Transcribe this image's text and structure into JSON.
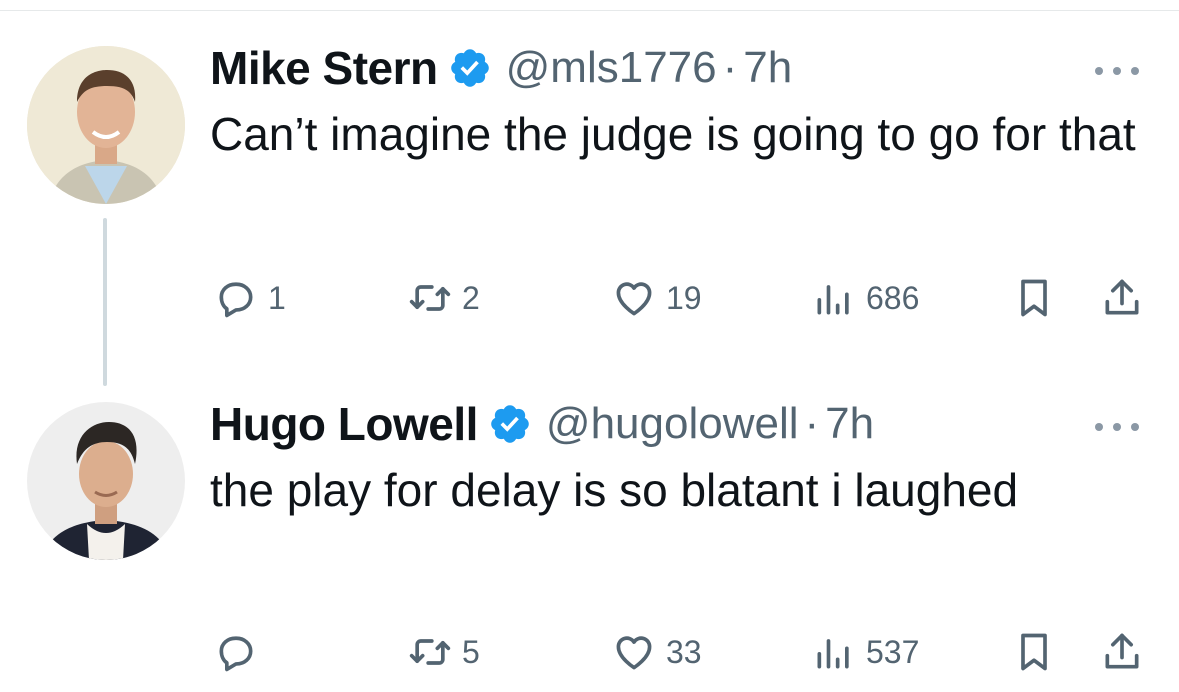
{
  "tweets": [
    {
      "name": "Mike Stern",
      "handle": "@mls1776",
      "separator": "·",
      "time": "7h",
      "text": "Can’t imagine the judge is going to go for that",
      "replies": "1",
      "retweets": "2",
      "likes": "19",
      "views": "686"
    },
    {
      "name": "Hugo Lowell",
      "handle": "@hugolowell",
      "separator": "·",
      "time": "7h",
      "text": "the play for delay is so blatant i laughed",
      "replies": "",
      "retweets": "5",
      "likes": "33",
      "views": "537"
    }
  ],
  "colors": {
    "verified": "#1d9bf0",
    "muted": "#536471",
    "thread_line": "#cfd9de"
  },
  "icons": [
    "verified-badge-icon",
    "more-icon",
    "reply-icon",
    "retweet-icon",
    "like-icon",
    "views-icon",
    "bookmark-icon",
    "share-icon"
  ]
}
